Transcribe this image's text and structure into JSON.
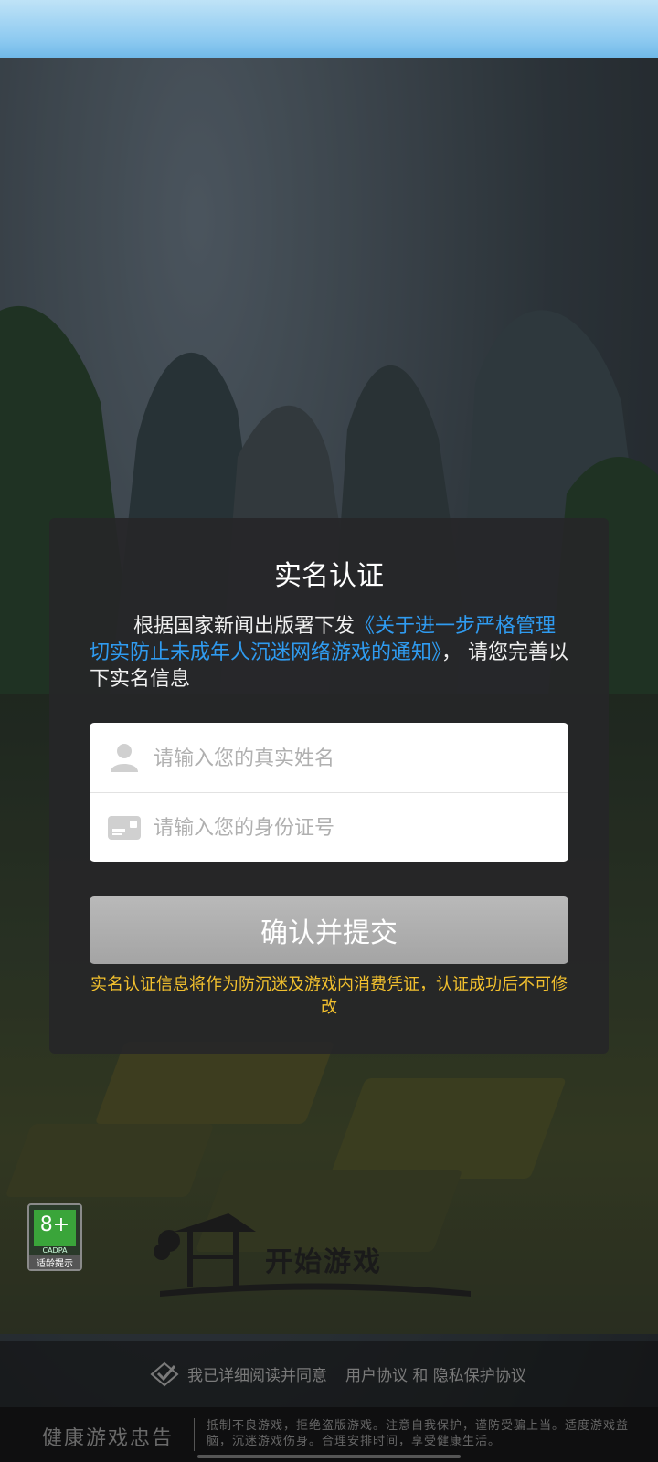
{
  "modal": {
    "title": "实名认证",
    "notice_prefix": "根据国家新闻出版署下发",
    "notice_link": "《关于进一步严格管理 切实防止未成年人沉迷网络游戏的通知》",
    "notice_suffix": "， 请您完善以下实名信息",
    "name_placeholder": "请输入您的真实姓名",
    "id_placeholder": "请输入您的身份证号",
    "submit_label": "确认并提交",
    "warning": "实名认证信息将作为防沉迷及游戏内消费凭证，认证成功后不可修改"
  },
  "age_rating": {
    "value": "8+",
    "org": "CADPA",
    "tip": "适龄提示"
  },
  "start_game": {
    "label": "开始游戏"
  },
  "agreement": {
    "text": "我已详细阅读并同意",
    "links": "用户协议 和 隐私保护协议"
  },
  "health_notice": {
    "title": "健康游戏忠告",
    "text": "抵制不良游戏，拒绝盗版游戏。注意自我保护，谨防受骗上当。适度游戏益脑，沉迷游戏伤身。合理安排时间，享受健康生活。"
  },
  "colors": {
    "link": "#2f9bf0",
    "warning": "#f2c02e",
    "submit_bg": "#a8a8a8"
  }
}
